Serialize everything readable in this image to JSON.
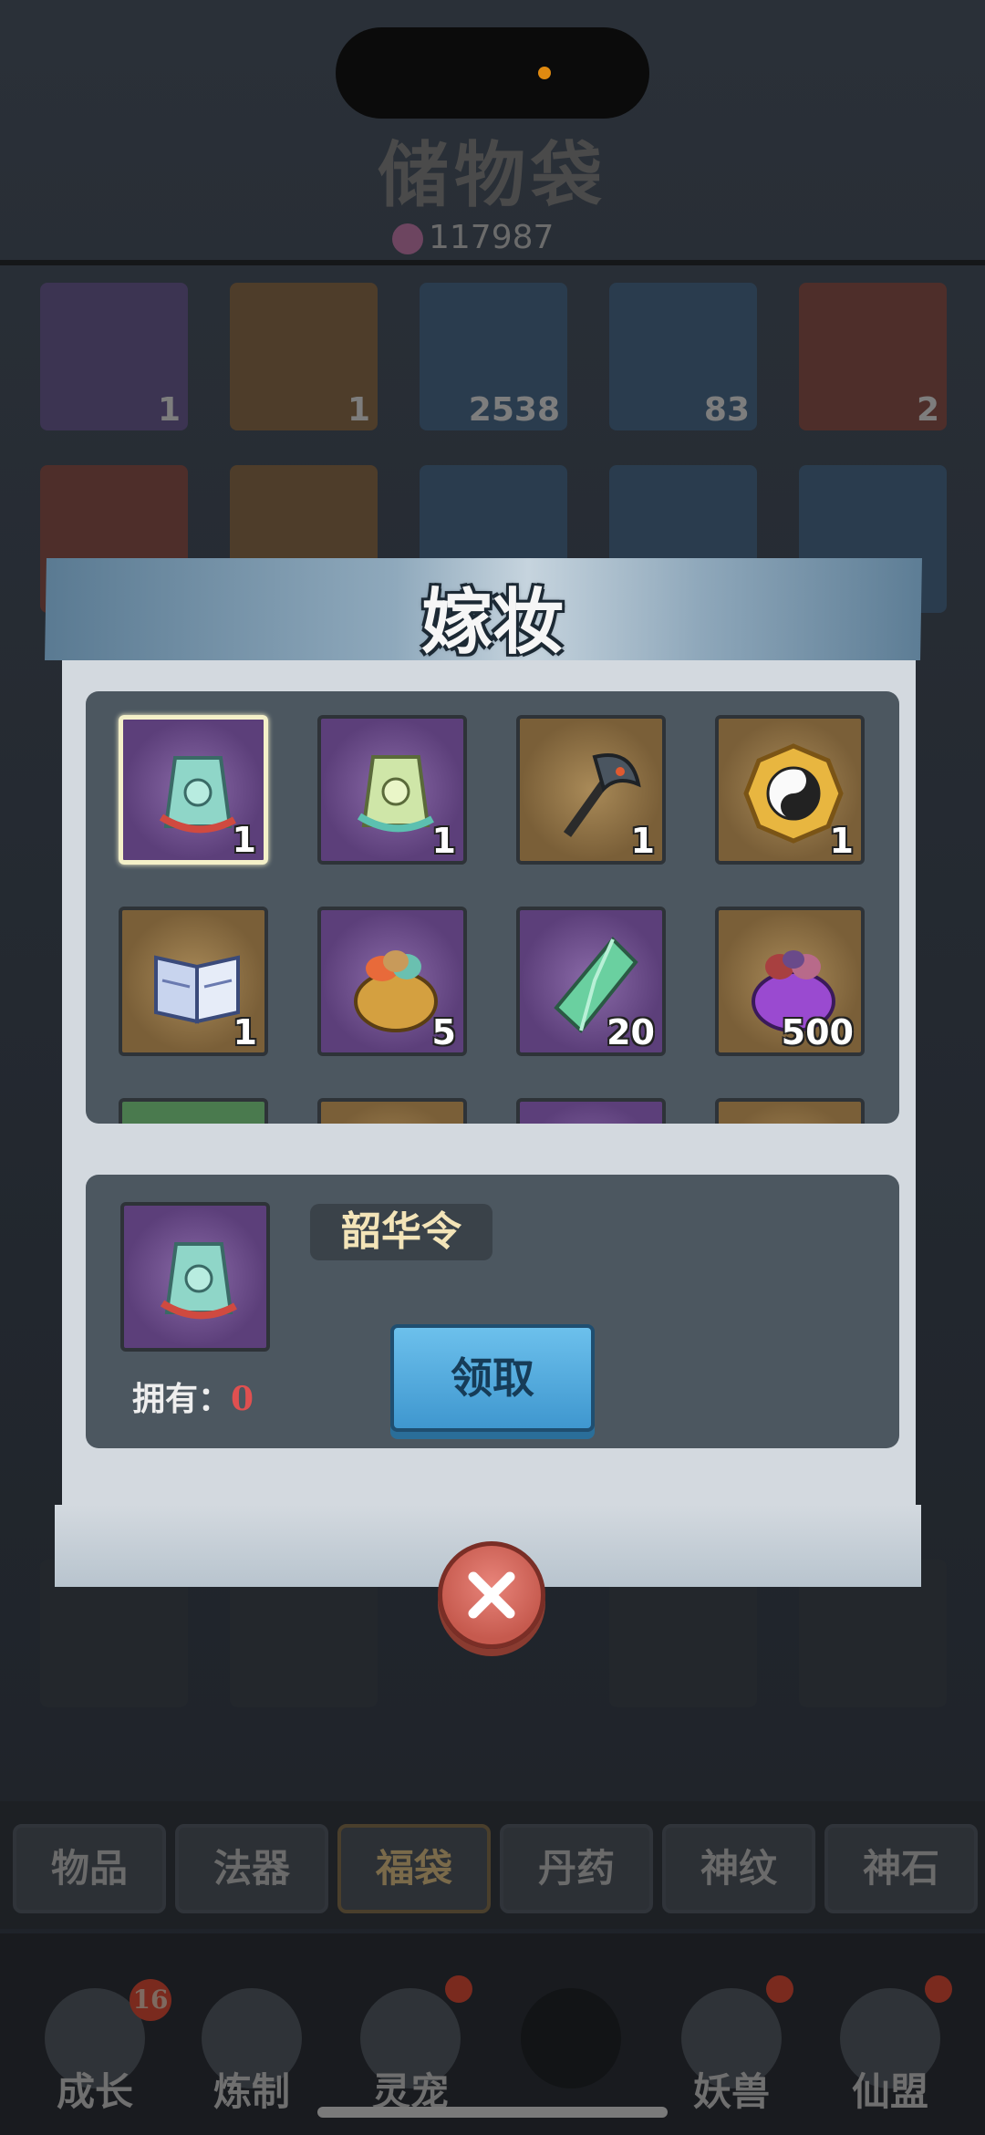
{
  "status_bar": {},
  "background": {
    "title": "储物袋",
    "currency_value": "117987",
    "grid_counts": [
      "1",
      "1",
      "2538",
      "83",
      "2"
    ],
    "tabs": [
      "物品",
      "法器",
      "福袋",
      "丹药",
      "神纹",
      "神石"
    ],
    "nav": [
      {
        "label": "成长",
        "badge": "16"
      },
      {
        "label": "炼制",
        "badge": ""
      },
      {
        "label": "灵宠",
        "badge": ""
      },
      {
        "label": "",
        "badge": ""
      },
      {
        "label": "妖兽",
        "badge": ""
      },
      {
        "label": "仙盟",
        "badge": ""
      }
    ]
  },
  "dialog": {
    "title": "嫁妆",
    "rewards": [
      {
        "icon": "token-tag-icon",
        "count": "1",
        "bg": "purple",
        "selected": true
      },
      {
        "icon": "token-tag-icon",
        "count": "1",
        "bg": "purple",
        "selected": false
      },
      {
        "icon": "dragon-axe-icon",
        "count": "1",
        "bg": "gold",
        "selected": false
      },
      {
        "icon": "yin-yang-icon",
        "count": "1",
        "bg": "gold",
        "selected": false
      },
      {
        "icon": "book-icon",
        "count": "1",
        "bg": "gold",
        "selected": false
      },
      {
        "icon": "pouch-icon",
        "count": "5",
        "bg": "purple",
        "selected": false
      },
      {
        "icon": "crystal-icon",
        "count": "20",
        "bg": "purple",
        "selected": false
      },
      {
        "icon": "purple-pouch-icon",
        "count": "500",
        "bg": "gold",
        "selected": false
      }
    ],
    "detail": {
      "item_name": "韶华令",
      "owned_label": "拥有：",
      "owned_value": "0",
      "claim_label": "领取"
    }
  },
  "colors": {
    "panel": "#4c5760",
    "dialog_bg": "#d3d9df",
    "claim_button": "#4fa8dc",
    "close_button": "#d96a5e",
    "owned_value": "#e05050"
  }
}
